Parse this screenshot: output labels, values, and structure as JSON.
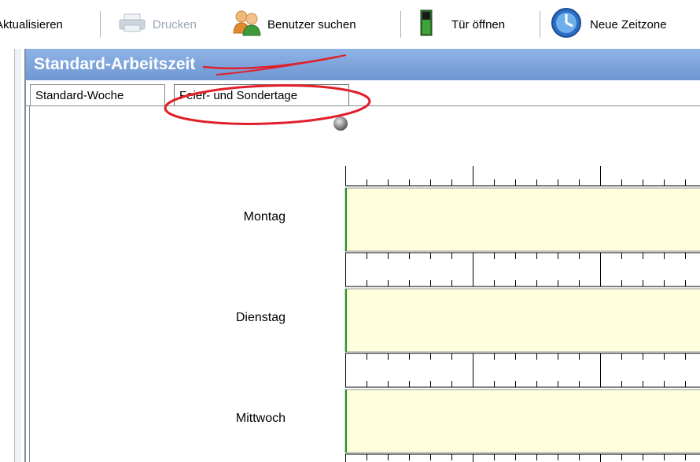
{
  "toolbar": {
    "refresh_label": "Aktualisieren",
    "print_label": "Drucken",
    "user_search_label": "Benutzer suchen",
    "open_door_label": "Tür öffnen",
    "new_timezone_label": "Neue Zeitzone"
  },
  "window": {
    "title": "Standard-Arbeitszeit",
    "tabs": [
      {
        "label": "Standard-Woche"
      },
      {
        "label": "Feier- und Sondertage"
      }
    ]
  },
  "schedule": {
    "days": [
      {
        "label": "Montag"
      },
      {
        "label": "Dienstag"
      },
      {
        "label": "Mittwoch"
      }
    ]
  },
  "colors": {
    "title_bar": "#7fa6dd",
    "schedule_bar": "#ffffdd",
    "annotation": "#e0202a",
    "active_marker": "#1a9a1a"
  },
  "icons": {
    "refresh": "refresh-icon",
    "print": "printer-icon",
    "user_search": "users-icon",
    "open_door": "door-icon",
    "new_timezone": "clock-icon",
    "tab_indicator": "moon-icon"
  }
}
